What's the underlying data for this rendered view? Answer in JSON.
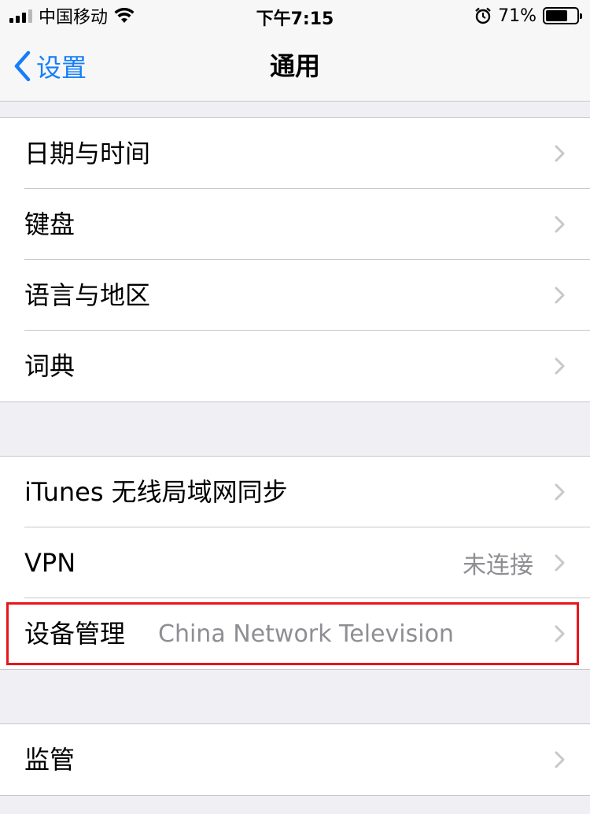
{
  "status_bar": {
    "carrier": "中国移动",
    "time": "下午7:15",
    "battery_percent": "71%",
    "battery_level": 0.71,
    "icons": [
      "signal-icon",
      "wifi-icon",
      "alarm-icon",
      "battery-icon"
    ]
  },
  "nav": {
    "back_label": "设置",
    "title": "通用"
  },
  "groups": [
    {
      "rows": [
        {
          "label": "日期与时间"
        },
        {
          "label": "键盘"
        },
        {
          "label": "语言与地区"
        },
        {
          "label": "词典"
        }
      ]
    },
    {
      "rows": [
        {
          "label": "iTunes 无线局域网同步"
        },
        {
          "label": "VPN",
          "value": "未连接"
        },
        {
          "label": "设备管理",
          "value": "China Network Television"
        }
      ]
    },
    {
      "rows": [
        {
          "label": "监管"
        }
      ]
    }
  ],
  "colors": {
    "accent": "#147efb",
    "highlight": "#e8151b",
    "secondary_text": "#8e8e93",
    "background": "#efeff4"
  }
}
